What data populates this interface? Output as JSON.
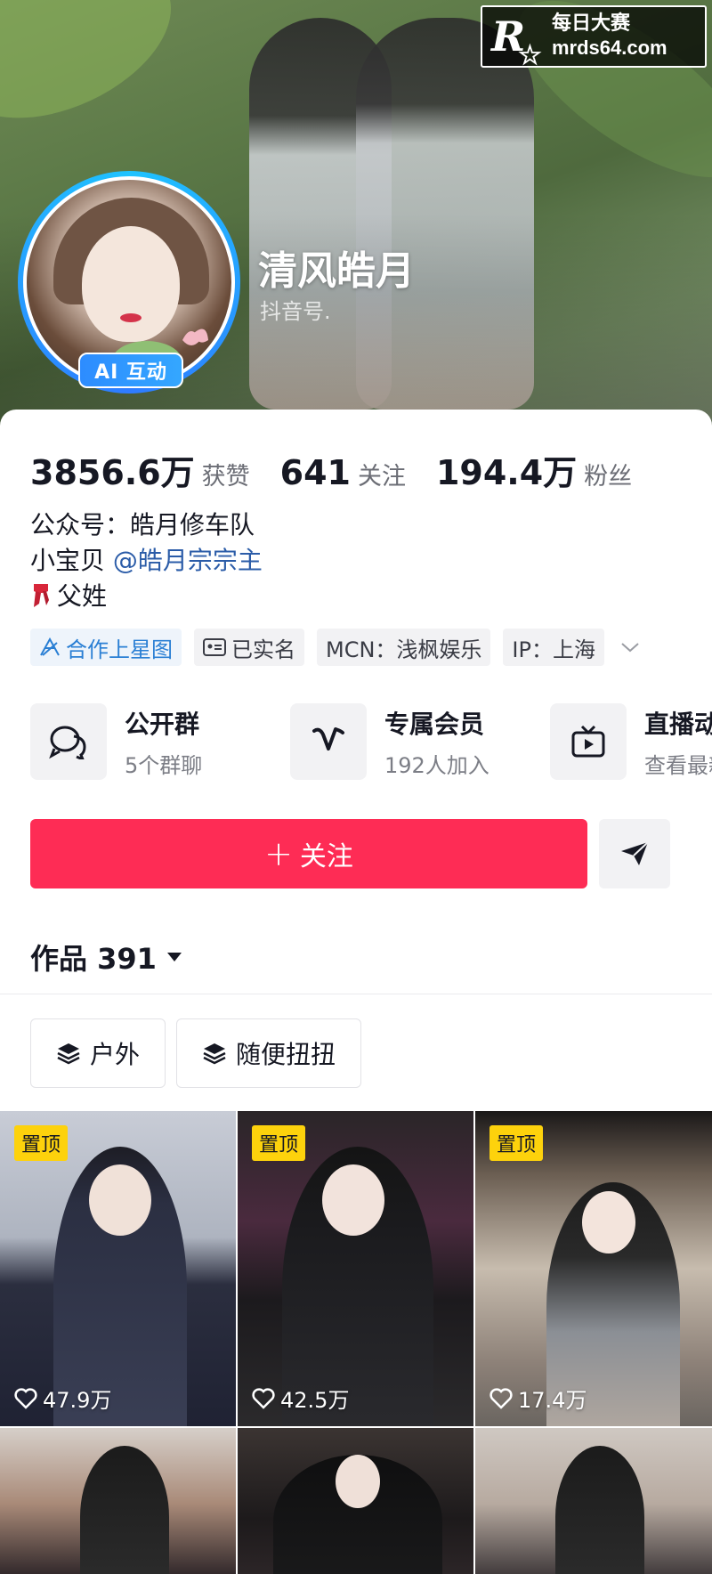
{
  "watermark": {
    "brand": "每日大赛",
    "url": "mrds64.com",
    "logo_letter": "R"
  },
  "profile": {
    "nickname": "清风皓月",
    "douyin_id_label": "抖音号.",
    "ai_badge": "AI 互动"
  },
  "stats": [
    {
      "value": "3856.6万",
      "label": "获赞"
    },
    {
      "value": "641",
      "label": "关注"
    },
    {
      "value": "194.4万",
      "label": "粉丝"
    }
  ],
  "bio": {
    "line1": "公众号：皓月修车队",
    "line2_prefix": "小宝贝 ",
    "line2_mention": "@皓月宗宗主",
    "line3": "父姓"
  },
  "tags": [
    {
      "label": "合作上星图",
      "icon": "star-map-icon"
    },
    {
      "label": "已实名",
      "icon": "id-card-icon"
    },
    {
      "label": "MCN：浅枫娱乐"
    },
    {
      "label": "IP：上海"
    }
  ],
  "features": [
    {
      "title": "公开群",
      "subtitle": "5个群聊",
      "icon": "group-chat-icon"
    },
    {
      "title": "专属会员",
      "subtitle": "192人加入",
      "icon": "member-v-icon"
    },
    {
      "title": "直播动态",
      "subtitle": "查看最新直播",
      "icon": "tv-icon"
    }
  ],
  "follow_button": {
    "label": "关注"
  },
  "works": {
    "title": "作品 391"
  },
  "collections": [
    {
      "label": "户外",
      "icon": "layers-icon"
    },
    {
      "label": "随便扭扭",
      "icon": "layers-icon"
    }
  ],
  "grid": [
    {
      "pinned": "置顶",
      "likes": "47.9万"
    },
    {
      "pinned": "置顶",
      "likes": "42.5万"
    },
    {
      "pinned": "置顶",
      "likes": "17.4万"
    },
    {
      "pinned": "",
      "likes": ""
    },
    {
      "pinned": "",
      "likes": ""
    },
    {
      "pinned": "",
      "likes": ""
    }
  ],
  "colors": {
    "accent": "#fe2c55",
    "pin": "#fdd20c",
    "mention": "#2b5ca8",
    "ring": "#2f7bff"
  }
}
